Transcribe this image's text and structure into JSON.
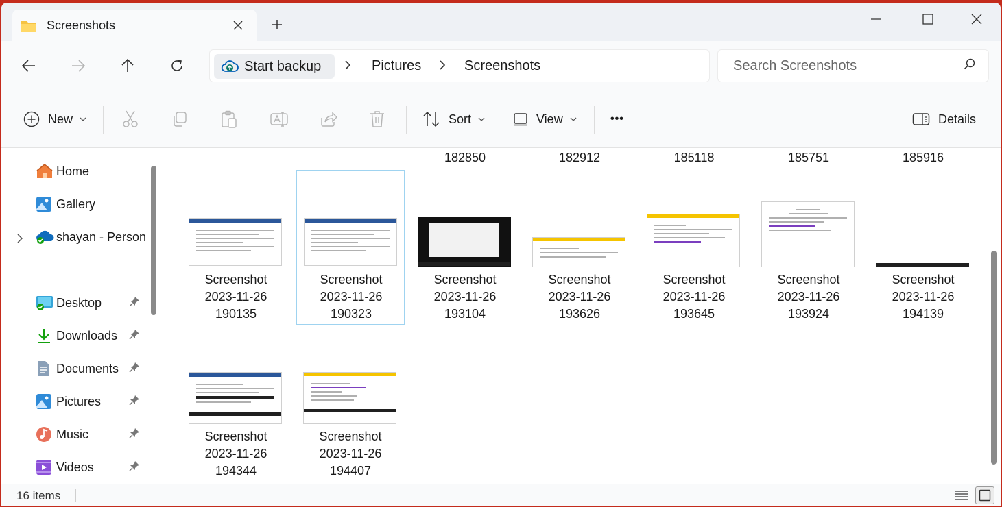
{
  "window": {
    "tab_title": "Screenshots",
    "colors": {
      "accent": "#005fb8",
      "folder": "#f6c343",
      "frame": "#c42b1c"
    }
  },
  "address": {
    "backup_label": "Start backup",
    "crumbs": [
      "Pictures",
      "Screenshots"
    ],
    "search_placeholder": "Search Screenshots"
  },
  "commands": {
    "new": "New",
    "sort": "Sort",
    "view": "View",
    "more": "•••",
    "details": "Details"
  },
  "sidebar": {
    "items": [
      {
        "label": "Home",
        "icon": "home-icon"
      },
      {
        "label": "Gallery",
        "icon": "gallery-icon"
      },
      {
        "label": "shayan - Persona",
        "icon": "onedrive-icon"
      },
      {
        "label": "Desktop",
        "icon": "desktop-icon"
      },
      {
        "label": "Downloads",
        "icon": "download-icon"
      },
      {
        "label": "Documents",
        "icon": "documents-icon"
      },
      {
        "label": "Pictures",
        "icon": "pictures-icon"
      },
      {
        "label": "Music",
        "icon": "music-icon"
      },
      {
        "label": "Videos",
        "icon": "videos-icon"
      }
    ]
  },
  "files": {
    "partial_row": [
      "182850",
      "182912",
      "185118",
      "185751",
      "185916"
    ],
    "tiles": [
      {
        "line1": "Screenshot",
        "line2": "2023-11-26",
        "line3": "190135"
      },
      {
        "line1": "Screenshot",
        "line2": "2023-11-26",
        "line3": "190323"
      },
      {
        "line1": "Screenshot",
        "line2": "2023-11-26",
        "line3": "193104"
      },
      {
        "line1": "Screenshot",
        "line2": "2023-11-26",
        "line3": "193626"
      },
      {
        "line1": "Screenshot",
        "line2": "2023-11-26",
        "line3": "193645"
      },
      {
        "line1": "Screenshot",
        "line2": "2023-11-26",
        "line3": "193924"
      },
      {
        "line1": "Screenshot",
        "line2": "2023-11-26",
        "line3": "194139"
      },
      {
        "line1": "Screenshot",
        "line2": "2023-11-26",
        "line3": "194344"
      },
      {
        "line1": "Screenshot",
        "line2": "2023-11-26",
        "line3": "194407"
      }
    ]
  },
  "status": {
    "count": "16 items"
  }
}
